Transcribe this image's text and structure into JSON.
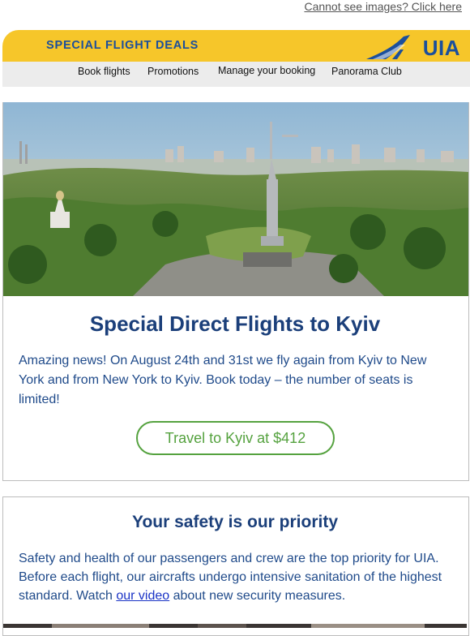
{
  "header": {
    "cannot_see_link": "Cannot see images? Click here",
    "banner_title": "SPECIAL FLIGHT DEALS",
    "logo_text": "UIA"
  },
  "nav": {
    "items": [
      {
        "label": "Book flights"
      },
      {
        "label": "Promotions"
      },
      {
        "label": "Manage your booking"
      },
      {
        "label": "Panorama Club"
      }
    ]
  },
  "section1": {
    "title": "Special Direct Flights to Kyiv",
    "body": "Amazing news! On August 24th and 31st we fly again from Kyiv to New York and from New York to Kyiv. Book today – the number of seats is limited!",
    "cta_label": "Travel to Kyiv at $412"
  },
  "section2": {
    "title": "Your safety is our priority",
    "body_before_link": "Safety and health of our passengers and crew are the top priority for UIA. Before each flight, our aircrafts undergo intensive sanitation of the highest standard. Watch ",
    "link_text": "our video",
    "body_after_link": " about new security measures."
  },
  "colors": {
    "brand_yellow": "#f6c62a",
    "brand_blue": "#1b4f9c",
    "title_blue": "#1b3f7a",
    "cta_green": "#55a23f"
  }
}
